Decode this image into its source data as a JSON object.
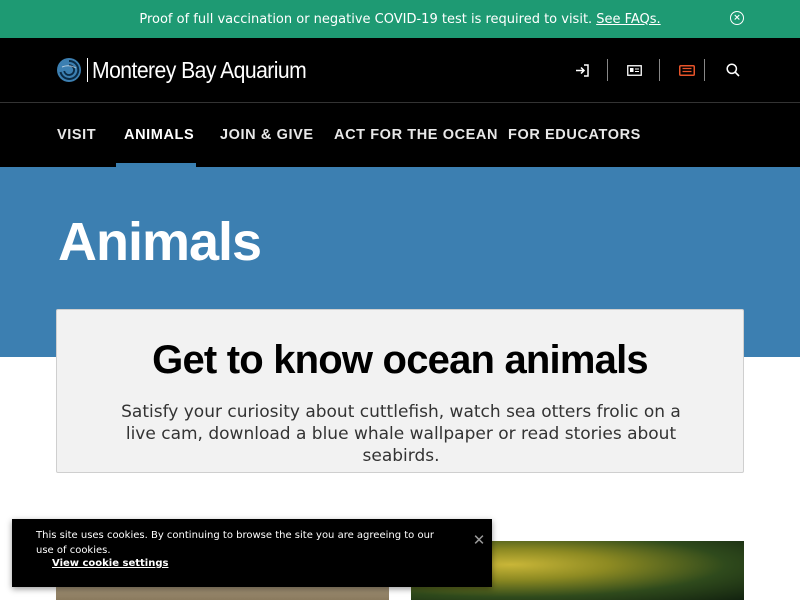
{
  "alert": {
    "text": "Proof of full vaccination or negative COVID-19 test is required to visit.",
    "link": "See FAQs.",
    "close_icon": "close-circle-icon"
  },
  "header": {
    "logo_text": "Monterey Bay Aquarium",
    "utility_icons": [
      "sign-in-icon",
      "membership-card-icon",
      "ticket-icon",
      "search-icon"
    ],
    "ticket_icon_color": "#e8542a"
  },
  "nav": {
    "items": [
      {
        "label": "VISIT"
      },
      {
        "label": "ANIMALS"
      },
      {
        "label": "JOIN & GIVE"
      },
      {
        "label": "ACT FOR THE OCEAN"
      },
      {
        "label": "FOR EDUCATORS"
      }
    ],
    "active": "ANIMALS"
  },
  "hero": {
    "title": "Animals",
    "background": "#3c7fb1"
  },
  "intro": {
    "title": "Get to know ocean animals",
    "body": "Satisfy your curiosity about cuttlefish, watch sea otters frolic on a live cam, download a blue whale wallpaper or read stories about seabirds."
  },
  "cookie": {
    "text": "This site uses cookies. By continuing to browse the site you are agreeing to our use of cookies.",
    "link": "View cookie settings",
    "close_icon": "close-icon"
  },
  "colors": {
    "alert_bg": "#1e9a73",
    "accent_blue": "#3c7fb1",
    "header_bg": "#000000"
  }
}
